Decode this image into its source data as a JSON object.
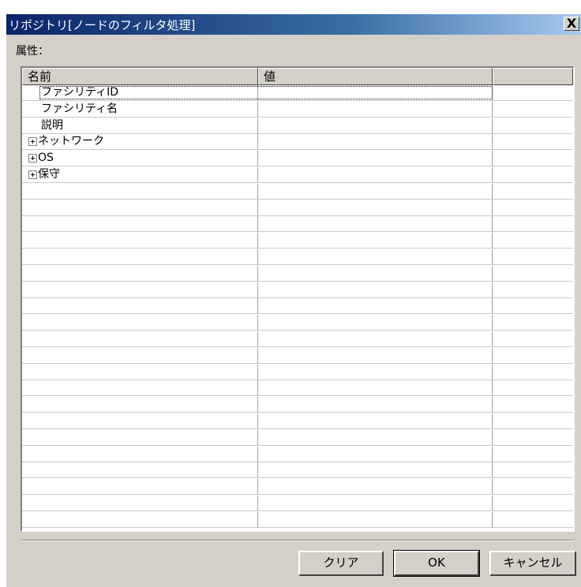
{
  "window": {
    "title": "リポジトリ[ノードのフィルタ処理]",
    "close_label": "X"
  },
  "attributes_label": "属性：",
  "grid": {
    "columns": [
      "名前",
      "値",
      ""
    ],
    "rows": [
      {
        "name": "ファシリティID",
        "value": "",
        "expandable": false
      },
      {
        "name": "ファシリティ名",
        "value": "",
        "expandable": false
      },
      {
        "name": "説明",
        "value": "",
        "expandable": false
      },
      {
        "name": "ネットワーク",
        "value": "",
        "expandable": true
      },
      {
        "name": "OS",
        "value": "",
        "expandable": true
      },
      {
        "name": "保守",
        "value": "",
        "expandable": true
      }
    ],
    "empty_row_count": 21
  },
  "buttons": {
    "clear": "クリア",
    "ok": "OK",
    "cancel": "キャンセル"
  }
}
